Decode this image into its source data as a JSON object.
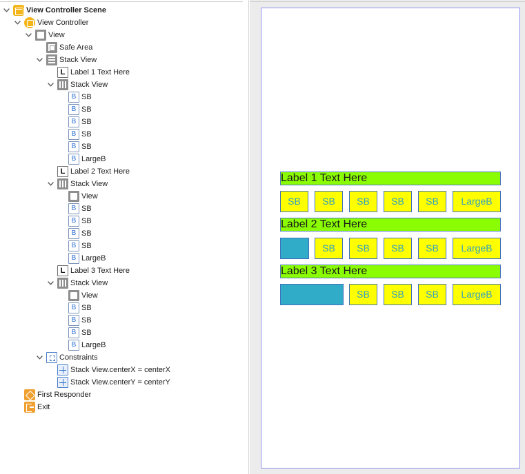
{
  "outline": {
    "items": [
      {
        "label": "View Controller Scene",
        "icon": "scene-icon",
        "disclosure": "open",
        "bold": true
      },
      {
        "label": "View Controller",
        "icon": "view-controller-icon",
        "disclosure": "open"
      },
      {
        "label": "View",
        "icon": "view-icon",
        "disclosure": "open"
      },
      {
        "label": "Safe Area",
        "icon": "safe-area-icon",
        "disclosure": "none"
      },
      {
        "label": "Stack View",
        "icon": "vertical-stack-icon",
        "disclosure": "open"
      },
      {
        "label": "Label 1 Text Here",
        "icon": "label-icon",
        "disclosure": "none"
      },
      {
        "label": "Stack View",
        "icon": "horizontal-stack-icon",
        "disclosure": "open"
      },
      {
        "label": "SB",
        "icon": "button-icon",
        "disclosure": "none"
      },
      {
        "label": "SB",
        "icon": "button-icon",
        "disclosure": "none"
      },
      {
        "label": "SB",
        "icon": "button-icon",
        "disclosure": "none"
      },
      {
        "label": "SB",
        "icon": "button-icon",
        "disclosure": "none"
      },
      {
        "label": "SB",
        "icon": "button-icon",
        "disclosure": "none"
      },
      {
        "label": "LargeB",
        "icon": "button-icon",
        "disclosure": "none"
      },
      {
        "label": "Label 2 Text Here",
        "icon": "label-icon",
        "disclosure": "none"
      },
      {
        "label": "Stack View",
        "icon": "horizontal-stack-icon",
        "disclosure": "open"
      },
      {
        "label": "View",
        "icon": "view-icon",
        "disclosure": "none"
      },
      {
        "label": "SB",
        "icon": "button-icon",
        "disclosure": "none"
      },
      {
        "label": "SB",
        "icon": "button-icon",
        "disclosure": "none"
      },
      {
        "label": "SB",
        "icon": "button-icon",
        "disclosure": "none"
      },
      {
        "label": "SB",
        "icon": "button-icon",
        "disclosure": "none"
      },
      {
        "label": "LargeB",
        "icon": "button-icon",
        "disclosure": "none"
      },
      {
        "label": "Label 3 Text Here",
        "icon": "label-icon",
        "disclosure": "none"
      },
      {
        "label": "Stack View",
        "icon": "horizontal-stack-icon",
        "disclosure": "open"
      },
      {
        "label": "View",
        "icon": "view-icon",
        "disclosure": "none"
      },
      {
        "label": "SB",
        "icon": "button-icon",
        "disclosure": "none"
      },
      {
        "label": "SB",
        "icon": "button-icon",
        "disclosure": "none"
      },
      {
        "label": "SB",
        "icon": "button-icon",
        "disclosure": "none"
      },
      {
        "label": "LargeB",
        "icon": "button-icon",
        "disclosure": "none"
      },
      {
        "label": "Constraints",
        "icon": "constraints-icon",
        "disclosure": "open"
      },
      {
        "label": "Stack View.centerX = centerX",
        "icon": "constraint-icon",
        "disclosure": "none"
      },
      {
        "label": "Stack View.centerY = centerY",
        "icon": "constraint-icon",
        "disclosure": "none"
      },
      {
        "label": "First Responder",
        "icon": "first-responder-icon",
        "disclosure": "none"
      },
      {
        "label": "Exit",
        "icon": "exit-icon",
        "disclosure": "none"
      }
    ]
  },
  "canvas": {
    "label1": "Label 1 Text Here",
    "label2": "Label 2 Text Here",
    "label3": "Label 3 Text Here",
    "row1": [
      "SB",
      "SB",
      "SB",
      "SB",
      "SB",
      "LargeB"
    ],
    "row2": [
      "SB",
      "SB",
      "SB",
      "SB",
      "LargeB"
    ],
    "row3": [
      "SB",
      "SB",
      "SB",
      "LargeB"
    ]
  },
  "colors": {
    "label_background": "#8afc03",
    "button_background": "#ffff00",
    "button_text": "#2f9fc2",
    "spacer_view": "#31acc8",
    "border": "#3f6fbf",
    "device_border": "#8c8ef0",
    "icon_orange": "#f3b519",
    "icon_gray": "#8e8e8e"
  }
}
